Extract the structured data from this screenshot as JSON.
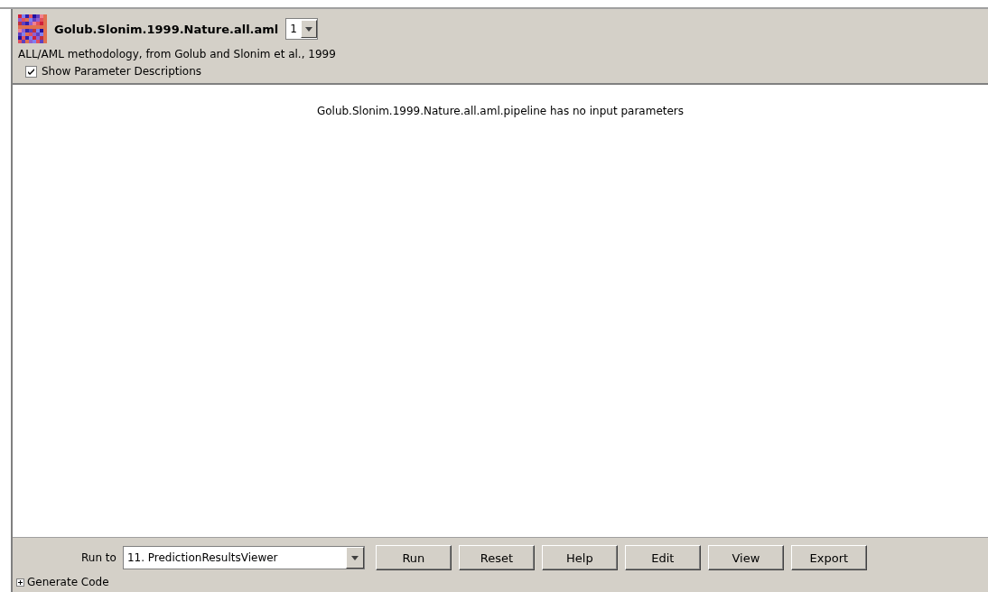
{
  "header": {
    "title": "Golub.Slonim.1999.Nature.all.aml",
    "version": "1",
    "description": "ALL/AML methodology, from Golub and Slonim et al., 1999",
    "show_descriptions": {
      "label": "Show Parameter Descriptions",
      "checked": true
    }
  },
  "message": "Golub.Slonim.1999.Nature.all.aml.pipeline has no input parameters",
  "footer": {
    "run_to_label": "Run to",
    "run_to_value": "11. PredictionResultsViewer",
    "buttons": [
      "Run",
      "Reset",
      "Help",
      "Edit",
      "View",
      "Export"
    ],
    "generate_code": {
      "label": "Generate Code",
      "expanded": false
    }
  }
}
